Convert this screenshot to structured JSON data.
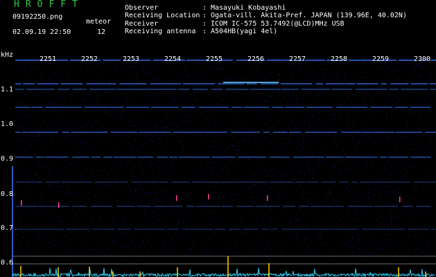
{
  "header": {
    "title": "HROFFT",
    "filename": "09192250.png",
    "meteor_label": "meteor",
    "datetime": "02.09.19 22:50",
    "meteor_count": "12",
    "info": [
      {
        "key": "Observer",
        "value": "Masayuki Kobayashi"
      },
      {
        "key": "Receiving Location",
        "value": "Ogata-vill. Akita-Pref. JAPAN (139.96E, 40.02N)"
      },
      {
        "key": "Receiver",
        "value": "ICOM IC-575 53.7492(@LCD)MHz USB"
      },
      {
        "key": "Receiving antenna",
        "value": "A504HB(yagi 4el)"
      }
    ]
  },
  "axis": {
    "y_unit": "kHz",
    "y_ticks": [
      "1.1",
      "1.0",
      "0.9",
      "0.8",
      "0.7",
      "0.6"
    ],
    "x_ticks": [
      "2251",
      "2252",
      "2253",
      "2254",
      "2255",
      "2256",
      "2257",
      "2258",
      "2259",
      "2300"
    ]
  },
  "colors": {
    "background": "#000000",
    "title": "#2ecc40",
    "carrier": "#3a7bff",
    "echo": "#ff4d8a",
    "noise": "#141466",
    "bottom_trace": "#33d6ff",
    "spike": "#ffd400",
    "baseline": "#b8b8b8"
  }
}
